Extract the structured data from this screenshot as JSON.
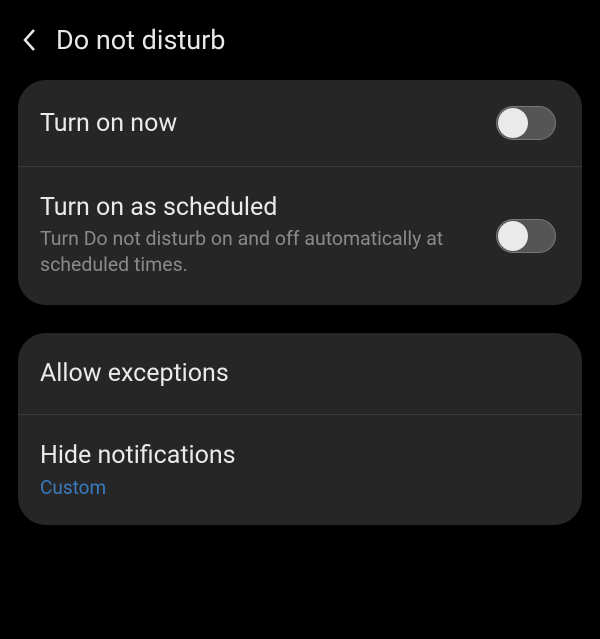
{
  "header": {
    "title": "Do not disturb"
  },
  "card1": {
    "row1": {
      "title": "Turn on now",
      "toggle": false
    },
    "row2": {
      "title": "Turn on as scheduled",
      "subtitle": "Turn Do not disturb on and off automatically at scheduled times.",
      "toggle": false
    }
  },
  "card2": {
    "row1": {
      "title": "Allow exceptions"
    },
    "row2": {
      "title": "Hide notifications",
      "link": "Custom"
    }
  }
}
